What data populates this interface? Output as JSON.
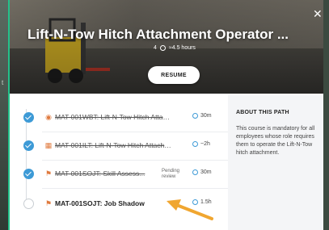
{
  "backdrop": {
    "peek_text": "t"
  },
  "hero": {
    "title": "Lift-N-Tow Hitch Attachment Operator ...",
    "count": "4",
    "duration": "≈4.5 hours",
    "resume_label": "RESUME",
    "close_glyph": "✕"
  },
  "items": [
    {
      "type_icon": "video-icon",
      "glyph": "◉",
      "title": "MAT-001WBT: Lift-N-Tow Hitch Attach...",
      "duration": "30m",
      "status": "complete",
      "pending": ""
    },
    {
      "type_icon": "calendar-icon",
      "glyph": "▦",
      "title": "MAT-001ILT: Lift-N-Tow Hitch Attachm...",
      "duration": "~2h",
      "status": "complete",
      "pending": ""
    },
    {
      "type_icon": "flag-icon",
      "glyph": "⚑",
      "title": "MAT-001SOJT: Skill Assess...",
      "duration": "30m",
      "status": "complete",
      "pending": "Pending review"
    },
    {
      "type_icon": "flag-icon",
      "glyph": "⚑",
      "title": "MAT-001SOJT: Job Shadow",
      "duration": "1.5h",
      "status": "todo",
      "pending": ""
    }
  ],
  "about": {
    "heading": "ABOUT THIS PATH",
    "body": "This course is mandatory for all employees whose role requires them to operate the Lift-N-Tow hitch attachment."
  },
  "colors": {
    "accent": "#3d9ad6",
    "arrow": "#f0a630",
    "border": "#23c28a"
  }
}
